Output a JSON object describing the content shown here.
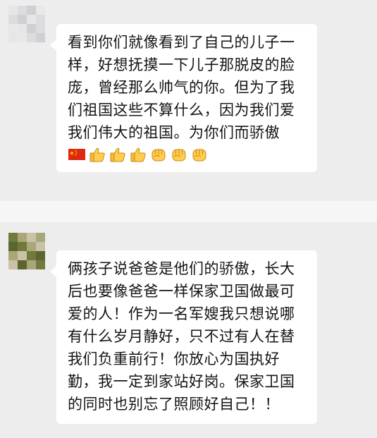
{
  "messages": [
    {
      "lines": [
        "看到你们就像看到了自己的儿子一",
        "样，好想抚摸一下儿子那脱皮的脸",
        "庞，曾经那么帅气的你。但为了我",
        "们祖国这些不算什么，因为我们爱",
        "我们伟大的祖国。为你们而骄傲"
      ],
      "emojis": [
        "china-flag-icon",
        "thumbs-up-icon",
        "thumbs-up-icon",
        "thumbs-up-icon",
        "fist-icon",
        "fist-icon",
        "fist-icon"
      ]
    },
    {
      "lines": [
        "俩孩子说爸爸是他们的骄傲，长大",
        "后也要像爸爸一样保家卫国做最可",
        "爱的人！作为一名军嫂我只想说哪",
        "有什么岁月静好，只不过有人在替",
        "我们负重前行！你放心为国执好",
        "勤，我一定到家站好岗。保家卫国",
        "的同时也别忘了照顾好自己！！"
      ]
    }
  ],
  "colors": {
    "background": "#ededed",
    "bubble": "#ffffff",
    "text": "#141414",
    "avatar1": [
      "#e6e6e8",
      "#dcdcdf",
      "#cfd0d4",
      "#e8e8ea"
    ],
    "avatar2": [
      "#6f7a3c",
      "#a9a77a",
      "#5c6530",
      "#c9c2a6"
    ]
  }
}
